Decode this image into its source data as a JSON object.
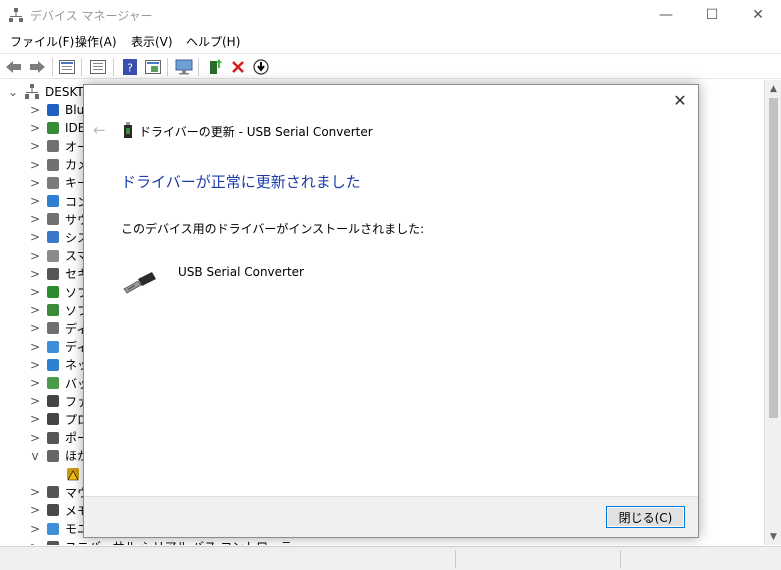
{
  "window": {
    "title": "デバイス マネージャー",
    "minimize": "—",
    "maximize": "☐",
    "close": "✕"
  },
  "menu": [
    "ファイル(F)",
    "操作(A)",
    "表示(V)",
    "ヘルプ(H)"
  ],
  "toolbar": {
    "buttons": [
      "back-icon",
      "forward-icon",
      "properties-icon",
      "view-icon",
      "help-icon",
      "view-details-icon",
      "monitor-icon",
      "update-driver-icon",
      "uninstall-icon",
      "download-icon"
    ]
  },
  "tree": {
    "root": "DESKTO",
    "items": [
      {
        "label": "Blu",
        "icon": "bluetooth-icon",
        "expander": ">"
      },
      {
        "label": "IDE",
        "icon": "ide-icon",
        "expander": ">"
      },
      {
        "label": "オー",
        "icon": "audio-icon",
        "expander": ">"
      },
      {
        "label": "カメ",
        "icon": "camera-icon",
        "expander": ">"
      },
      {
        "label": "キー",
        "icon": "keyboard-icon",
        "expander": ">"
      },
      {
        "label": "コン",
        "icon": "computer-icon",
        "expander": ">"
      },
      {
        "label": "サウ",
        "icon": "sound-icon",
        "expander": ">"
      },
      {
        "label": "シス",
        "icon": "system-icon",
        "expander": ">"
      },
      {
        "label": "スマ",
        "icon": "smartcard-icon",
        "expander": ">"
      },
      {
        "label": "セキ",
        "icon": "security-icon",
        "expander": ">"
      },
      {
        "label": "ソフ",
        "icon": "software-component-icon",
        "expander": ">"
      },
      {
        "label": "ソフ",
        "icon": "software-device-icon",
        "expander": ">"
      },
      {
        "label": "ディ",
        "icon": "disk-icon",
        "expander": ">"
      },
      {
        "label": "ディ",
        "icon": "display-icon",
        "expander": ">"
      },
      {
        "label": "ネッ",
        "icon": "network-icon",
        "expander": ">"
      },
      {
        "label": "バッ",
        "icon": "battery-icon",
        "expander": ">"
      },
      {
        "label": "ファ",
        "icon": "firmware-icon",
        "expander": ">"
      },
      {
        "label": "プロ",
        "icon": "processor-icon",
        "expander": ">"
      },
      {
        "label": "ポー",
        "icon": "port-icon",
        "expander": ">"
      },
      {
        "label": "ほか",
        "icon": "other-devices-icon",
        "expander": "v"
      },
      {
        "label": "",
        "icon": "warning-device-icon",
        "expander": ""
      },
      {
        "label": "マウ",
        "icon": "mouse-icon",
        "expander": ">"
      },
      {
        "label": "メモ",
        "icon": "memory-icon",
        "expander": ">"
      },
      {
        "label": "モニ",
        "icon": "monitor-icon",
        "expander": ">"
      },
      {
        "label": "ユニバーサル シリアル バス コントローラー",
        "icon": "usb-controller-icon",
        "expander": ">"
      }
    ]
  },
  "dialog": {
    "close": "✕",
    "back": "←",
    "header": "ドライバーの更新 - USB Serial Converter",
    "heading": "ドライバーが正常に更新されました",
    "message": "このデバイス用のドライバーがインストールされました:",
    "device_name": "USB Serial Converter",
    "close_button": "閉じる(C)"
  },
  "colors": {
    "heading": "#1e3ca8",
    "button_border": "#0078d7"
  }
}
